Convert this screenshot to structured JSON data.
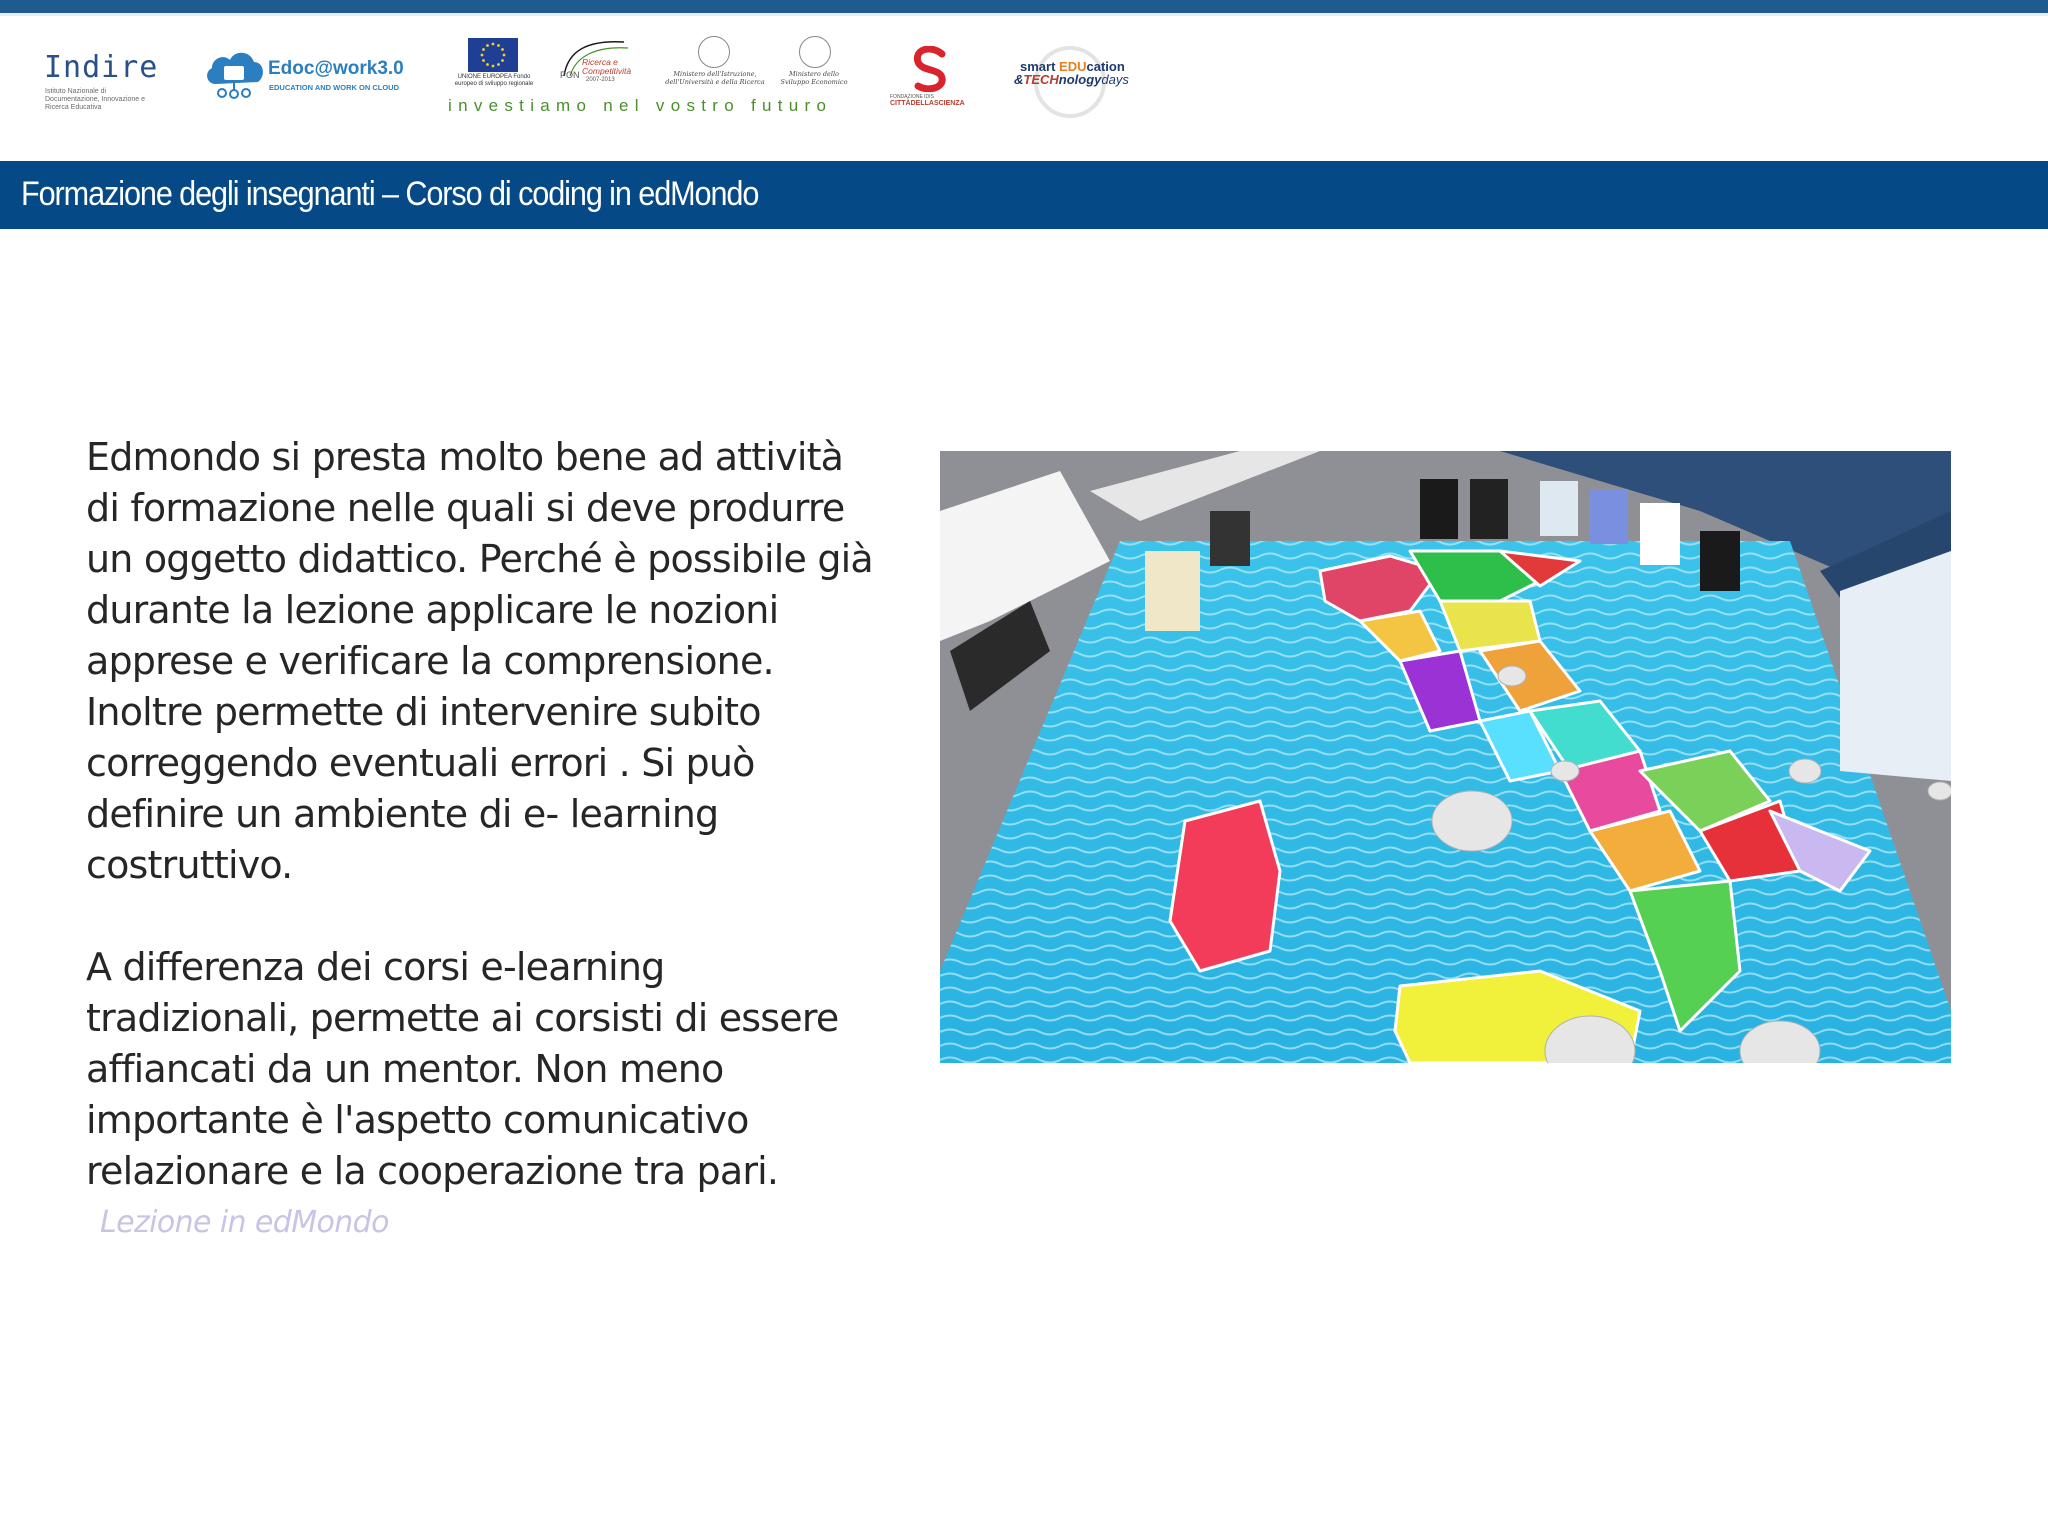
{
  "logos": {
    "indire": {
      "name": "Indire",
      "subtitle": "Istituto Nazionale di Documentazione, Innovazione e Ricerca Educativa"
    },
    "edoc": {
      "name": "Edoc@work3.0",
      "subtitle": "Education and work on cloud"
    },
    "pon": {
      "eu_label": "UNIONE EUROPEA Fondo europeo di sviluppo regionale",
      "pon_text": "Ricerca e Competitività",
      "pon_label": "PON",
      "pon_years": "2007-2013",
      "ministry1": "Ministero dell'Istruzione, dell'Università e della Ricerca",
      "ministry2": "Ministero dello Sviluppo Economico",
      "tagline": "investiamo nel vostro futuro"
    },
    "citta_scienza": {
      "line1": "FONDAZIONE IDIS",
      "line2": "CITTÀDELLASCIENZA"
    },
    "smart_education": {
      "line1_a": "smart ",
      "line1_b": "EDU",
      "line1_c": "cation",
      "line2_a": "&",
      "line2_b": "TECH",
      "line2_c": "nology",
      "line2_d": "days"
    }
  },
  "header": {
    "title": "Formazione degli insegnanti – Corso di coding in edMondo"
  },
  "content": {
    "paragraph1": "Edmondo si presta molto bene ad attività di formazione nelle quali si deve produrre un oggetto didattico. Perché è possibile già durante la lezione applicare le nozioni apprese e verificare la comprensione. Inoltre permette di intervenire subito correggendo eventuali errori . Si può definire un ambiente di e- learning costruttivo.",
    "paragraph2": "A differenza dei corsi e-learning tradizionali, permette ai corsisti di essere affiancati da un mentor. Non meno importante è l'aspetto comunicativo relazionare e la cooperazione tra pari.",
    "caption": "Lezione in edMondo"
  },
  "colors": {
    "header_band": "#054a86",
    "top_strip": "#1f5b8e",
    "body_text": "#262626",
    "caption": "#c9c4e3",
    "tagline": "#4a8f2b"
  }
}
